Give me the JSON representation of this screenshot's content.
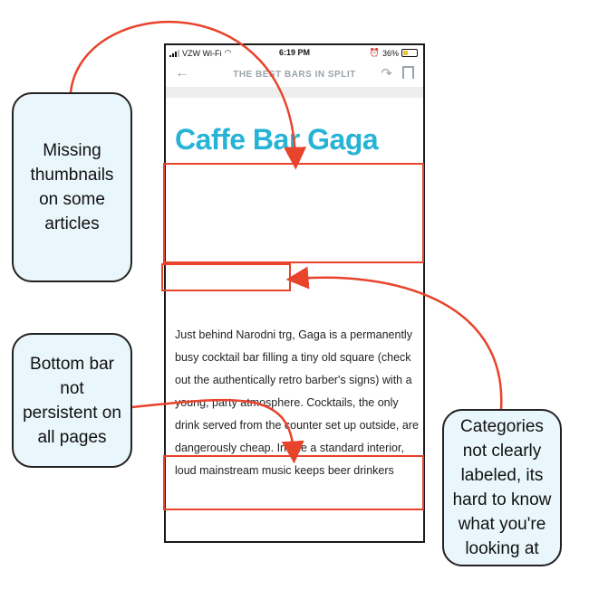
{
  "status_bar": {
    "carrier": "VZW Wi-Fi",
    "time": "6:19 PM",
    "battery": "36%"
  },
  "nav": {
    "title": "THE BEST BARS IN SPLIT",
    "back_icon": "back-arrow-icon",
    "share_icon": "share-icon",
    "bookmark_icon": "bookmark-icon"
  },
  "article": {
    "title": "Caffe Bar Gaga",
    "body": "Just behind Narodni trg, Gaga is a permanently busy cocktail bar filling a tiny old square (check out the authentically retro barber's signs) with a young, party atmosphere. Cocktails, the only drink served from the counter set up outside, are dangerously cheap. Inside a standard interior, loud mainstream music keeps beer drinkers"
  },
  "callouts": {
    "thumbnails": "Missing thumbnails on some articles",
    "bottom_bar": "Bottom bar not persistent on all pages",
    "categories": "Categories not clearly labeled, its hard to know what you're looking at"
  },
  "colors": {
    "accent_title": "#27b3d6",
    "annotation_red": "#e8432b",
    "callout_bg": "#e9f6fc"
  }
}
